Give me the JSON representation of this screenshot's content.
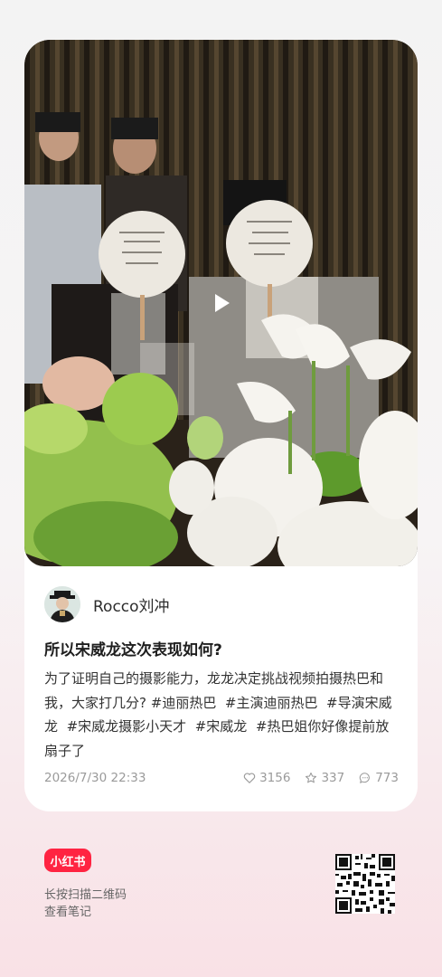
{
  "post": {
    "author_name": "Rocco刘冲",
    "title": "所以宋威龙这次表现如何?",
    "body_text": "为了证明自己的摄影能力，龙龙决定挑战视频拍摄热巴和我，大家打几分?",
    "hashtags": [
      "#迪丽热巴",
      "#主演迪丽热巴",
      "#导演宋威龙",
      "#宋威龙摄影小天才",
      "#宋威龙",
      "#热巴姐你好像提前放扇子了"
    ],
    "date": "2026/7/30 22:33",
    "likes": "3156",
    "collects": "337",
    "comments": "773"
  },
  "footer": {
    "brand": "小红书",
    "scan_line1": "长按扫描二维码",
    "scan_line2": "查看笔记"
  },
  "colors": {
    "brand_red": "#ff2442",
    "meta_gray": "#9a9a9a"
  },
  "icons": [
    "play-icon",
    "heart-icon",
    "star-icon",
    "comment-icon",
    "qr-code"
  ]
}
